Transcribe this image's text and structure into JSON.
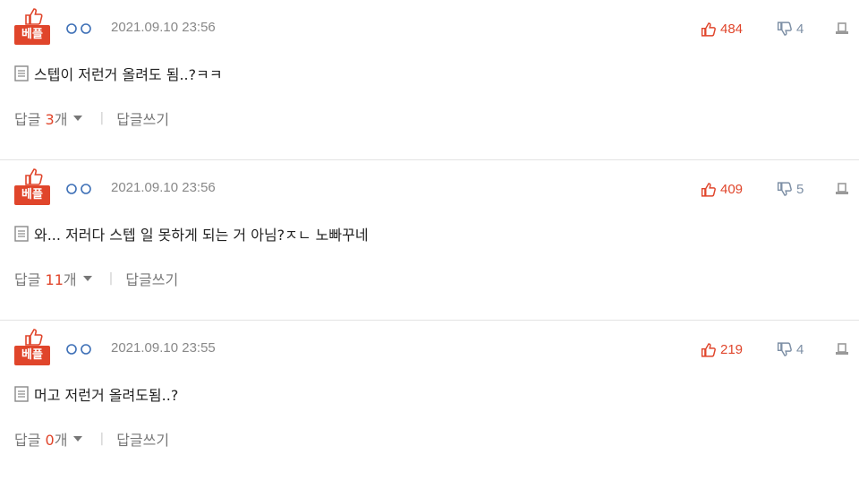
{
  "colors": {
    "accent": "#e0452b",
    "muted": "#888888",
    "dislike": "#7d8fa5",
    "divider": "#e3e3e3"
  },
  "comments": [
    {
      "badge": "베플",
      "nickname_icon": "anonymous-dots-icon",
      "timestamp": "2021.09.10 23:56",
      "likes": "484",
      "dislikes": "4",
      "text": "스텝이 저런거 올려도 됨..?ㅋㅋ",
      "reply_label": "답글",
      "reply_count": "3",
      "reply_unit": "개",
      "write_reply_label": "답글쓰기"
    },
    {
      "badge": "베플",
      "nickname_icon": "anonymous-dots-icon",
      "timestamp": "2021.09.10 23:56",
      "likes": "409",
      "dislikes": "5",
      "text": "와... 저러다 스텝 일 못하게 되는 거 아님?ㅈㄴ 노빠꾸네",
      "reply_label": "답글",
      "reply_count": "11",
      "reply_unit": "개",
      "write_reply_label": "답글쓰기"
    },
    {
      "badge": "베플",
      "nickname_icon": "anonymous-dots-icon",
      "timestamp": "2021.09.10 23:55",
      "likes": "219",
      "dislikes": "4",
      "text": "머고 저런거 올려도됨..?",
      "reply_label": "답글",
      "reply_count": "0",
      "reply_unit": "개",
      "write_reply_label": "답글쓰기"
    }
  ]
}
